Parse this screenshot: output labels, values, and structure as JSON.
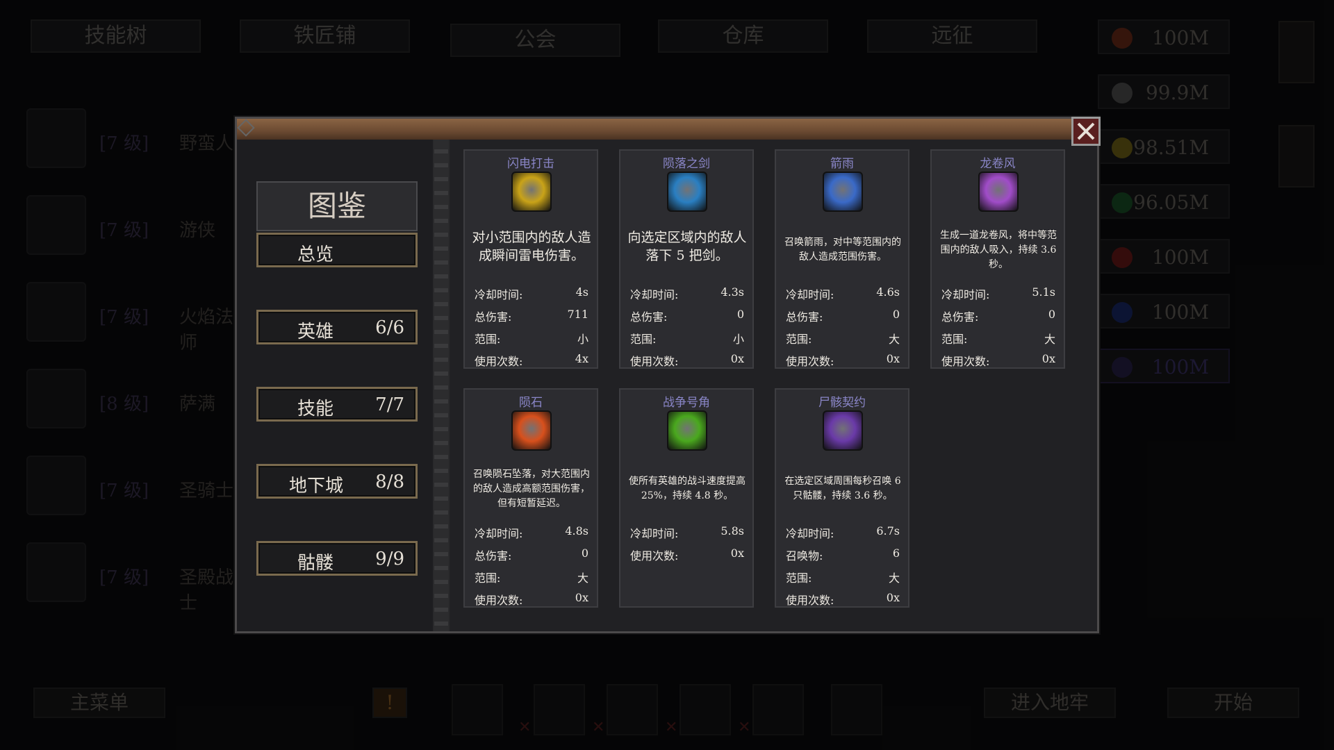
{
  "top_tabs": [
    "技能树",
    "铁匠铺",
    "公会",
    "仓库",
    "远征"
  ],
  "resources": [
    {
      "value": "100M",
      "color": "#c2411e"
    },
    {
      "value": "99.9M",
      "color": "#8a8a8a"
    },
    {
      "value": "98.51M",
      "color": "#d0b21a"
    },
    {
      "value": "96.05M",
      "color": "#1f8a3a"
    },
    {
      "value": "100M",
      "color": "#c01e1e"
    },
    {
      "value": "100M",
      "color": "#1e3fb8"
    },
    {
      "value": "100M",
      "color": "#3a2e7a"
    }
  ],
  "heroes": [
    {
      "level": "[7 级]",
      "name": "野蛮人"
    },
    {
      "level": "[7 级]",
      "name": "游侠"
    },
    {
      "level": "[7 级]",
      "name": "火焰法师"
    },
    {
      "level": "[8 级]",
      "name": "萨满"
    },
    {
      "level": "[7 级]",
      "name": "圣骑士"
    },
    {
      "level": "[7 级]",
      "name": "圣殿战士"
    }
  ],
  "bottom": {
    "main_menu": "主菜单",
    "enter_dungeon": "进入地牢",
    "start": "开始",
    "alert": "!"
  },
  "modal": {
    "title": "图鉴",
    "nav": [
      {
        "label": "总览",
        "count": ""
      },
      {
        "label": "英雄",
        "count": "6/6"
      },
      {
        "label": "技能",
        "count": "7/7"
      },
      {
        "label": "地下城",
        "count": "8/8"
      },
      {
        "label": "骷髅",
        "count": "9/9"
      }
    ],
    "cards": [
      {
        "title": "闪电打击",
        "icon": "lightning-icon",
        "color": "#c9a318",
        "desc": "对小范围内的敌人造成瞬间雷电伤害。",
        "stats": [
          [
            "冷却时间:",
            "4s"
          ],
          [
            "总伤害:",
            "711"
          ],
          [
            "范围:",
            "小"
          ],
          [
            "使用次数:",
            "4x"
          ]
        ]
      },
      {
        "title": "陨落之剑",
        "icon": "falling-sword-icon",
        "color": "#2a7fc2",
        "desc": "向选定区域内的敌人落下 5 把剑。",
        "stats": [
          [
            "冷却时间:",
            "4.3s"
          ],
          [
            "总伤害:",
            "0"
          ],
          [
            "范围:",
            "小"
          ],
          [
            "使用次数:",
            "0x"
          ]
        ]
      },
      {
        "title": "箭雨",
        "icon": "arrow-rain-icon",
        "color": "#3a6ac8",
        "desc": "召唤箭雨，对中等范围内的敌人造成范围伤害。",
        "stats": [
          [
            "冷却时间:",
            "4.6s"
          ],
          [
            "总伤害:",
            "0"
          ],
          [
            "范围:",
            "大"
          ],
          [
            "使用次数:",
            "0x"
          ]
        ]
      },
      {
        "title": "龙卷风",
        "icon": "tornado-icon",
        "color": "#a04cc8",
        "desc": "生成一道龙卷风，将中等范围内的敌人吸入，持续 3.6 秒。",
        "stats": [
          [
            "冷却时间:",
            "5.1s"
          ],
          [
            "总伤害:",
            "0"
          ],
          [
            "范围:",
            "大"
          ],
          [
            "使用次数:",
            "0x"
          ]
        ]
      },
      {
        "title": "陨石",
        "icon": "meteor-icon",
        "color": "#d8501c",
        "desc": "召唤陨石坠落，对大范围内的敌人造成高额范围伤害，但有短暂延迟。",
        "stats": [
          [
            "冷却时间:",
            "4.8s"
          ],
          [
            "总伤害:",
            "0"
          ],
          [
            "范围:",
            "大"
          ],
          [
            "使用次数:",
            "0x"
          ]
        ]
      },
      {
        "title": "战争号角",
        "icon": "war-horn-icon",
        "color": "#4aa81e",
        "desc": "使所有英雄的战斗速度提高 25%，持续 4.8 秒。",
        "stats": [
          [
            "冷却时间:",
            "5.8s"
          ],
          [
            "使用次数:",
            "0x"
          ]
        ]
      },
      {
        "title": "尸骸契约",
        "icon": "corpse-pact-icon",
        "color": "#6a3aa8",
        "desc": "在选定区域周围每秒召唤 6 只骷髅，持续 3.6 秒。",
        "stats": [
          [
            "冷却时间:",
            "6.7s"
          ],
          [
            "召唤物:",
            "6"
          ],
          [
            "范围:",
            "大"
          ],
          [
            "使用次数:",
            "0x"
          ]
        ]
      }
    ]
  }
}
